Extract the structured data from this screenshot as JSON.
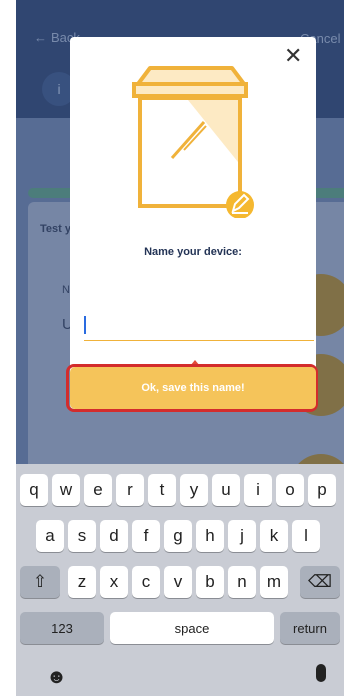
{
  "background": {
    "back_label": "Back",
    "cancel_label": "Cancel",
    "info_glyph": "i",
    "card_title": "Test your configuration",
    "field_label": "Name",
    "field_value": "U"
  },
  "modal": {
    "close_icon": "close-icon",
    "title": "Name your device:",
    "input_value": "",
    "save_button": "Ok, save this name!",
    "illustration": "box-with-pencil-icon"
  },
  "keyboard": {
    "row1": [
      "q",
      "w",
      "e",
      "r",
      "t",
      "y",
      "u",
      "i",
      "o",
      "p"
    ],
    "row2": [
      "a",
      "s",
      "d",
      "f",
      "g",
      "h",
      "j",
      "k",
      "l"
    ],
    "row3": [
      "z",
      "x",
      "c",
      "v",
      "b",
      "n",
      "m"
    ],
    "numbers_label": "123",
    "space_label": "space",
    "return_label": "return",
    "shift_icon": "shift-icon",
    "delete_icon": "backspace-icon",
    "emoji_icon": "emoji-icon",
    "mic_icon": "microphone-icon"
  },
  "colors": {
    "accent_yellow": "#f5c45a",
    "highlight_red": "#d32c2c",
    "navy": "#233355"
  }
}
